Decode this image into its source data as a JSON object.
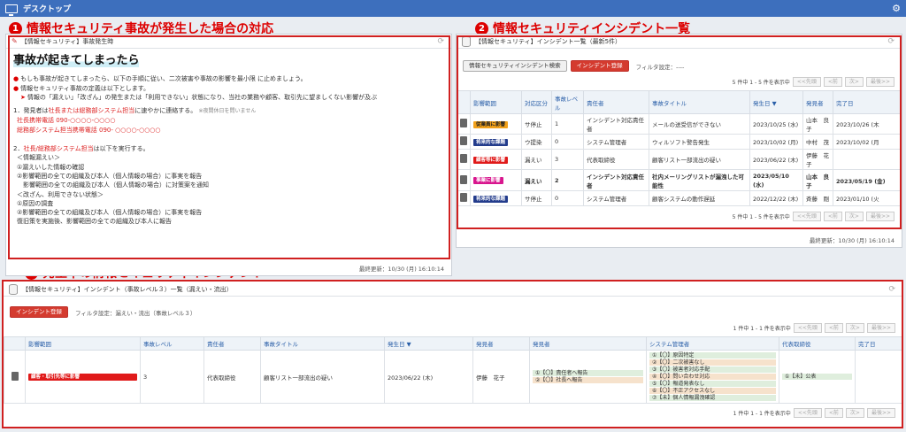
{
  "topbar": {
    "title": "デスクトップ",
    "settings_icon": "gear-icon"
  },
  "callouts": [
    {
      "num": "1",
      "label": "情報セキュリティ事故が発生した場合の対応"
    },
    {
      "num": "2",
      "label": "情報セキュリティインシデント一覧"
    },
    {
      "num": "3",
      "label": "発生中の情報セキュリティインシデント"
    }
  ],
  "panel1": {
    "title": "【情報セキュリティ】事故発生時",
    "heading": "事故が起きてしまったら",
    "bullet1": "もしも事故が起きてしまったら、以下の手順に従い、二次被害や事故の影響を最小限 に止めましょう。",
    "bullet2": "情報セキュリティ事故の定義は以下とします。",
    "sub": "情報の「漏えい」「改ざん」の発生または「利用できない」状態になり、当社の業務や顧客、取引先に望ましくない影響が及ぶ",
    "step1_a": "1．発見者は",
    "step1_red": "社長または総務部システム担当",
    "step1_b": "に速やかに連絡する。",
    "step1_note": "※夜間休日を問いません",
    "phone1": "社長携帯電話 090-○○○○-○○○○",
    "phone2": "総務部システム担当携帯電話 090- ○○○○-○○○○",
    "step2_a": "2．",
    "step2_red": "社長/総務部システム担当",
    "step2_b": "は以下を実行する。",
    "lines": [
      "＜情報漏えい＞",
      "①漏えいした情報の確認",
      "②影響範囲の全ての組織及び本人（個人情報の場合）に事実を報告",
      "　影響範囲の全ての組織及び本人（個人情報の場合）に対策案を通知",
      "＜改ざん、利用できない状態＞",
      "①原因の調査",
      "②影響範囲の全ての組織及び本人（個人情報の場合）に事実を報告",
      "復旧策を実施後、影響範囲の全ての組織及び本人に報告"
    ],
    "updated": "最終更新：10/30 (月) 16:10:14"
  },
  "panel2": {
    "title": "【情報セキュリティ】インシデント一覧（最新5件）",
    "search_btn": "情報セキュリティインシデント検索",
    "register_btn": "インシデント登録",
    "filter": "フィルタ設定：----",
    "count": "5 件中 1 - 5 件を表示中",
    "pager": [
      "<<先頭",
      "<前",
      "次>",
      "最後>>"
    ],
    "headers": [
      "影響範囲",
      "対応区分",
      "事故レベル",
      "責任者",
      "事故タイトル",
      "発生日 ▼",
      "発見者",
      "完了日"
    ],
    "rows": [
      {
        "scope": "従業員に影響",
        "tag": "t-orange",
        "kubun": "サ停止",
        "level": "1",
        "owner": "インシデント対応責任者",
        "title": "メールの送受信ができない",
        "date": "2023/10/25 (水)",
        "finder": "山本　良子",
        "done": "2023/10/26 (木"
      },
      {
        "scope": "将来的な課題",
        "tag": "t-blue",
        "kubun": "ウ提染",
        "level": "0",
        "owner": "システム管理者",
        "title": "ウィルソフト警告発生",
        "date": "2023/10/02 (月)",
        "finder": "中村　茂",
        "done": "2023/10/02 (月"
      },
      {
        "scope": "顧客等に影響",
        "tag": "t-red",
        "kubun": "漏えい",
        "level": "3",
        "owner": "代表取締役",
        "title": "顧客リスト一部流出の疑い",
        "date": "2023/06/22 (木)",
        "finder": "伊藤　花子",
        "done": ""
      },
      {
        "scope": "事業に影響",
        "tag": "t-pink",
        "kubun": "漏えい",
        "level": "2",
        "owner": "インシデント対応責任者",
        "title": "社内メーリングリストが漏洩した可能性",
        "date": "2023/05/10 (水)",
        "finder": "山本　良子",
        "done": "2023/05/19 (金)"
      },
      {
        "scope": "将来的な課題",
        "tag": "t-blue",
        "kubun": "サ停止",
        "level": "0",
        "owner": "システム管理者",
        "title": "顧客システムの動作遅延",
        "date": "2022/12/22 (木)",
        "finder": "斉藤　剛",
        "done": "2023/01/10 (火"
      }
    ],
    "updated": "最終更新：10/30 (月) 16:10:14"
  },
  "panel3": {
    "title": "【情報セキュリティ】インシデント（事故レベル３）一覧（漏えい・流出）",
    "register_btn": "インシデント登録",
    "filter": "フィルタ設定：漏えい・流出（事故レベル３）",
    "count": "1 件中 1 - 1 件を表示中",
    "pager": [
      "<<先頭",
      "<前",
      "次>",
      "最後>>"
    ],
    "headers": [
      "影響範囲",
      "事故レベル",
      "責任者",
      "事故タイトル",
      "発生日 ▼",
      "発見者",
      "発見者",
      "システム管理者",
      "代表取締役",
      "完了日"
    ],
    "row": {
      "scope": "顧客・取引先等に影響",
      "level": "3",
      "owner": "代表取締役",
      "title": "顧客リスト一部流出の疑い",
      "date": "2023/06/22 (木)",
      "finder": "伊藤　花子",
      "finder_steps": [
        "①【〇】責任者へ報告",
        "②【〇】社長へ報告"
      ],
      "admin_steps": [
        "①【〇】原因特定",
        "②【〇】二次被害なし",
        "③【〇】被害者対応手配",
        "④【〇】問い合わせ対応",
        "⑤【〇】報道発表なし",
        "⑥【〇】不正アクセスなし",
        "⑦【未】個人情報漏洩確認"
      ],
      "ceo_steps": [
        "①【未】公表"
      ],
      "done": ""
    }
  }
}
